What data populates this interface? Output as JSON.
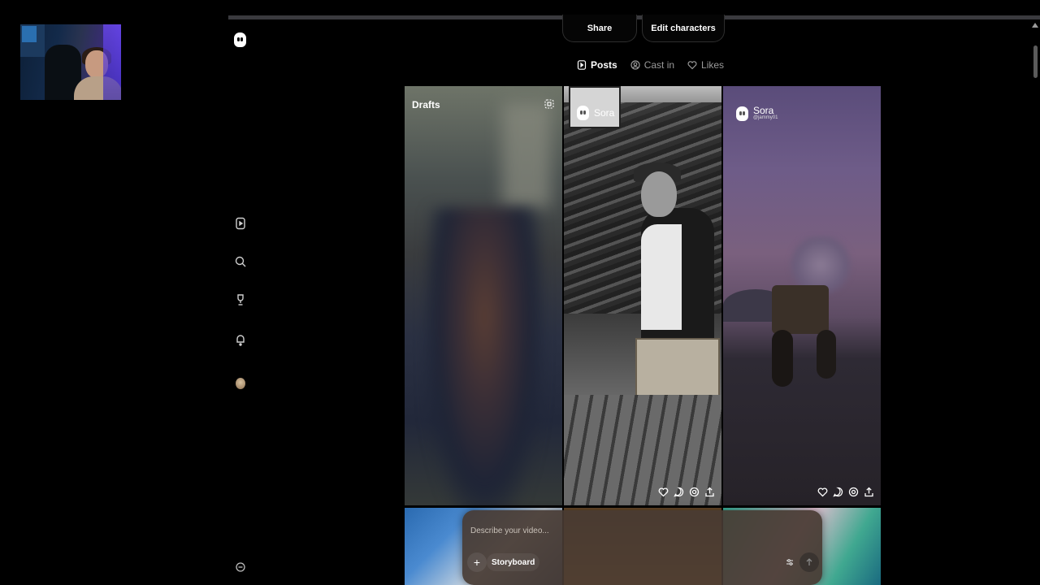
{
  "header": {
    "share_label": "Share",
    "edit_characters_label": "Edit characters"
  },
  "tabs": [
    {
      "label": "Posts",
      "icon": "play-square-icon",
      "active": true
    },
    {
      "label": "Cast in",
      "icon": "cameo-icon",
      "active": false
    },
    {
      "label": "Likes",
      "icon": "heart-icon",
      "active": false
    }
  ],
  "sidebar": {
    "items": [
      {
        "icon": "feed-play-icon"
      },
      {
        "icon": "search-icon"
      },
      {
        "icon": "trophy-icon"
      },
      {
        "icon": "bell-icon"
      },
      {
        "icon": "avatar"
      }
    ],
    "footer_icon": "settings-circle-icon"
  },
  "grid": {
    "drafts": {
      "title": "Drafts"
    },
    "posts": [
      {
        "author": "Sora",
        "handle": ""
      },
      {
        "author": "Sora",
        "handle": "@jammy01"
      }
    ]
  },
  "composer": {
    "placeholder": "Describe your video...",
    "storyboard_label": "Storyboard",
    "add_label": "+"
  }
}
